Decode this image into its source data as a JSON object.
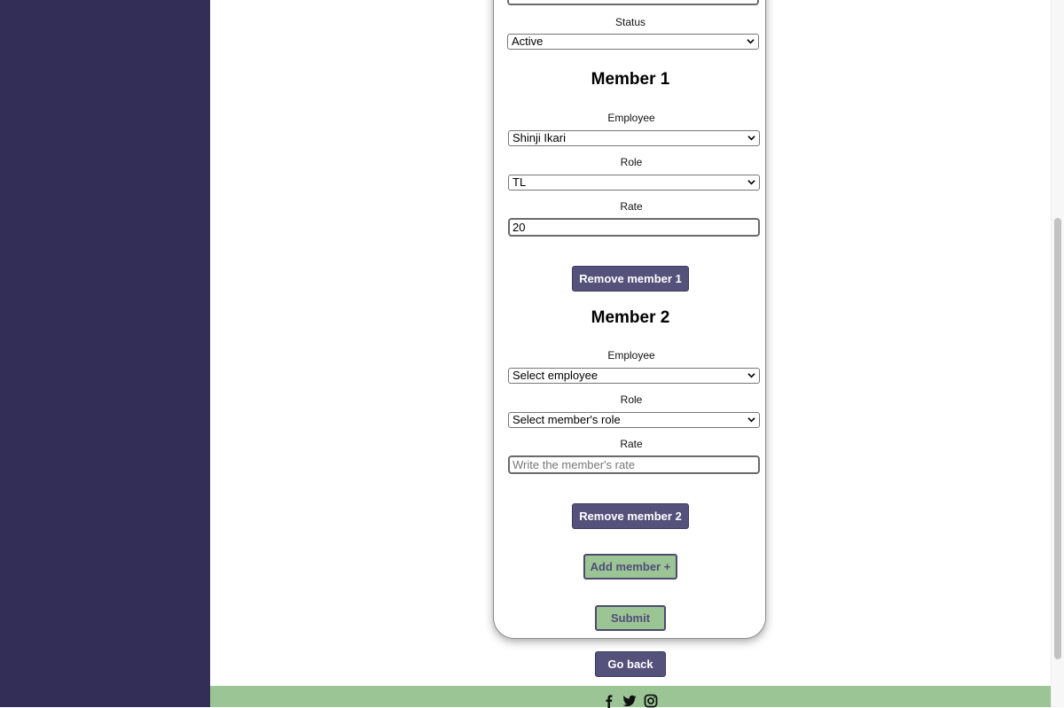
{
  "colors": {
    "sidebar": "#322e58",
    "primary_button": "#54527a",
    "secondary_button": "#9cc596",
    "footer": "#9cc596"
  },
  "form": {
    "status": {
      "label": "Status",
      "value": "Active"
    },
    "members": [
      {
        "heading": "Member 1",
        "employee_label": "Employee",
        "employee_value": "Shinji Ikari",
        "role_label": "Role",
        "role_value": "TL",
        "rate_label": "Rate",
        "rate_value": "20",
        "rate_placeholder": "",
        "remove_label": "Remove member 1"
      },
      {
        "heading": "Member 2",
        "employee_label": "Employee",
        "employee_value": "Select employee",
        "role_label": "Role",
        "role_value": "Select member's role",
        "rate_label": "Rate",
        "rate_value": "",
        "rate_placeholder": "Write the member's rate",
        "remove_label": "Remove member 2"
      }
    ],
    "add_member_label": "Add member +",
    "submit_label": "Submit"
  },
  "go_back_label": "Go back",
  "footer": {
    "icons": [
      "facebook-icon",
      "twitter-icon",
      "instagram-icon"
    ]
  }
}
